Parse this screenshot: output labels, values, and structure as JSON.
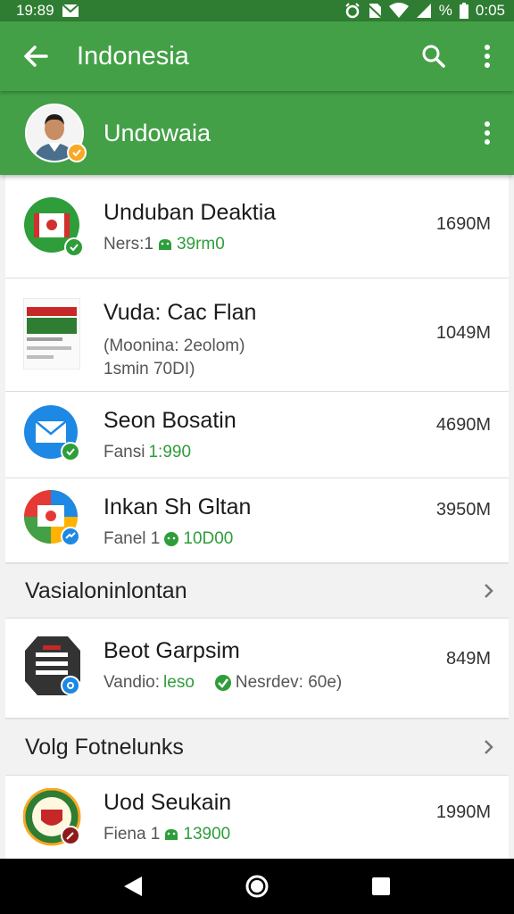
{
  "status_bar": {
    "time": "19:89",
    "battery_text": "%",
    "clock_right": "0:05"
  },
  "app_bar": {
    "title": "Indonesia"
  },
  "account": {
    "name": "Undowaia"
  },
  "apps": [
    {
      "title": "Unduban Deaktia",
      "sub_label": "Ners:1",
      "sub_value": "39rm0",
      "size": "1690M"
    },
    {
      "title": "Vuda: Cac Flan",
      "sub_line1": "(Moonina: 2eolom)",
      "sub_line2": "1smin 70DI)",
      "size": "1049M"
    },
    {
      "title": "Seon Bosatin",
      "sub_label": "Fansi",
      "sub_value": "1:990",
      "size": "4690M"
    },
    {
      "title": "Inkan Sh Gltan",
      "sub_label": "Fanel 1",
      "sub_value": "10D00",
      "size": "3950M"
    }
  ],
  "sections": [
    {
      "title": "Vasialoninlontan"
    },
    {
      "title": "Volg Fotnelunks"
    }
  ],
  "apps2": [
    {
      "title": "Beot Garpsim",
      "sub_label": "Vandio:",
      "sub_green": "leso",
      "sub_value": "Nesrdev: 60e)",
      "size": "849M"
    }
  ],
  "apps3": [
    {
      "title": "Uod Seukain",
      "sub_label": "Fiena 1",
      "sub_value": "13900",
      "size": "1990M"
    }
  ],
  "colors": {
    "primary": "#43a047",
    "primary_dark": "#2e7d32",
    "accent_green": "#2e9d3a"
  }
}
